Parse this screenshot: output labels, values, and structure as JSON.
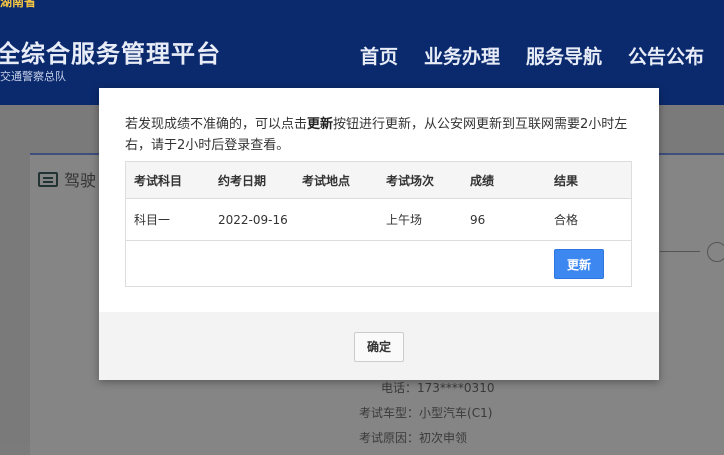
{
  "header": {
    "top_strip": "湖南省",
    "site_title": "全综合服务管理平台",
    "site_subtitle": "交通警察总队",
    "nav": [
      "首页",
      "业务办理",
      "服务导航",
      "公告公布"
    ]
  },
  "background": {
    "card_title": "驾驶",
    "info_rows": [
      {
        "label": "电话：",
        "value": "173****0310"
      },
      {
        "label": "考试车型：",
        "value": "小型汽车(C1)"
      },
      {
        "label": "考试原因：",
        "value": "初次申领"
      }
    ]
  },
  "modal": {
    "msg_prefix": "若发现成绩不准确的，可以点击",
    "msg_bold": "更新",
    "msg_suffix": "按钮进行更新，从公安网更新到互联网需要2小时左右，请于2小时后登录查看。",
    "table": {
      "headers": [
        "考试科目",
        "约考日期",
        "考试地点",
        "考试场次",
        "成绩",
        "结果"
      ],
      "rows": [
        [
          "科目一",
          "2022-09-16",
          "",
          "上午场",
          "96",
          "合格"
        ]
      ]
    },
    "update_button": "更新",
    "ok_button": "确定"
  }
}
